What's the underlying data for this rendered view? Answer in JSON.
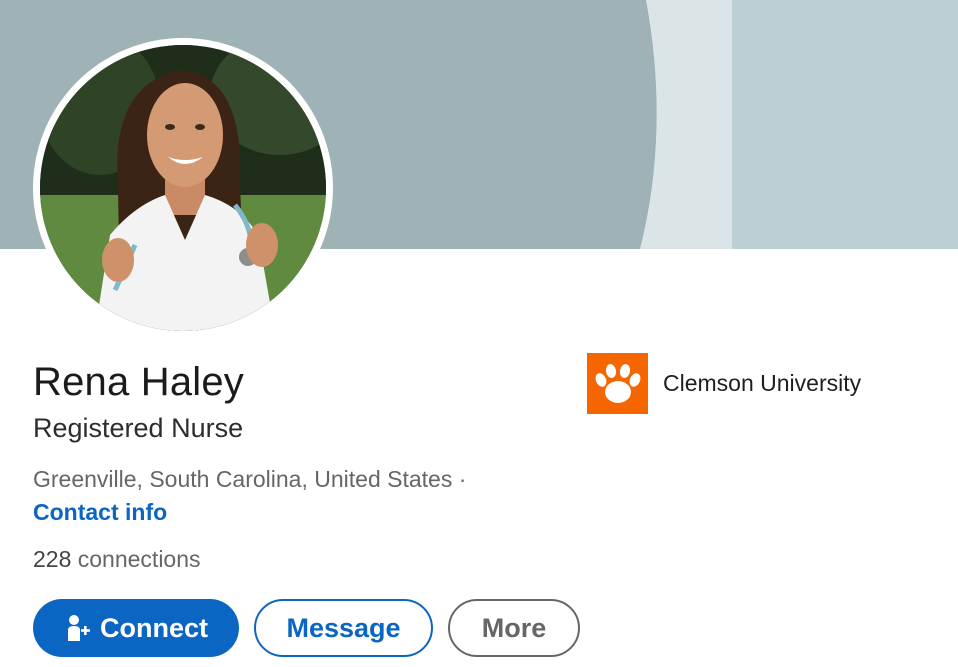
{
  "profile": {
    "name": "Rena Haley",
    "headline": "Registered Nurse",
    "location": "Greenville, South Carolina, United States ·",
    "contact_info": "Contact info",
    "connections_count": "228",
    "connections_label": "connections"
  },
  "education": {
    "school": "Clemson University",
    "logo_color": "#f56600"
  },
  "actions": {
    "connect": "Connect",
    "message": "Message",
    "more": "More"
  },
  "colors": {
    "accent": "#0a66c2",
    "banner": "#9fb2b6"
  },
  "icons": {
    "connect": "add-person-icon",
    "school": "paw-print-icon"
  }
}
